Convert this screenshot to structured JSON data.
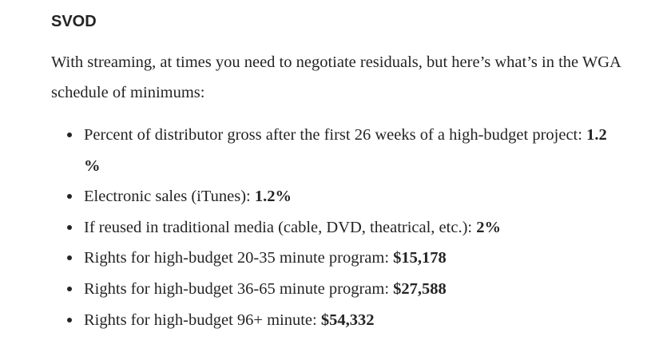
{
  "section": {
    "heading": "SVOD",
    "intro": "With streaming, at times you need to negotiate residuals, but here’s what’s in the WGA schedule of minimums:"
  },
  "bullets": [
    {
      "label": "Percent of distributor gross after the first 26 weeks of a high-budget project: ",
      "value": "1.2 %"
    },
    {
      "label": "Electronic sales (iTunes): ",
      "value": "1.2%"
    },
    {
      "label": "If reused in traditional media (cable, DVD, theatrical, etc.): ",
      "value": "2%"
    },
    {
      "label": "Rights for high-budget 20-35 minute program: ",
      "value": "$15,178"
    },
    {
      "label": "Rights for high-budget 36-65 minute program: ",
      "value": "$27,588"
    },
    {
      "label": "Rights for high-budget 96+ minute: ",
      "value": "$54,332"
    }
  ]
}
